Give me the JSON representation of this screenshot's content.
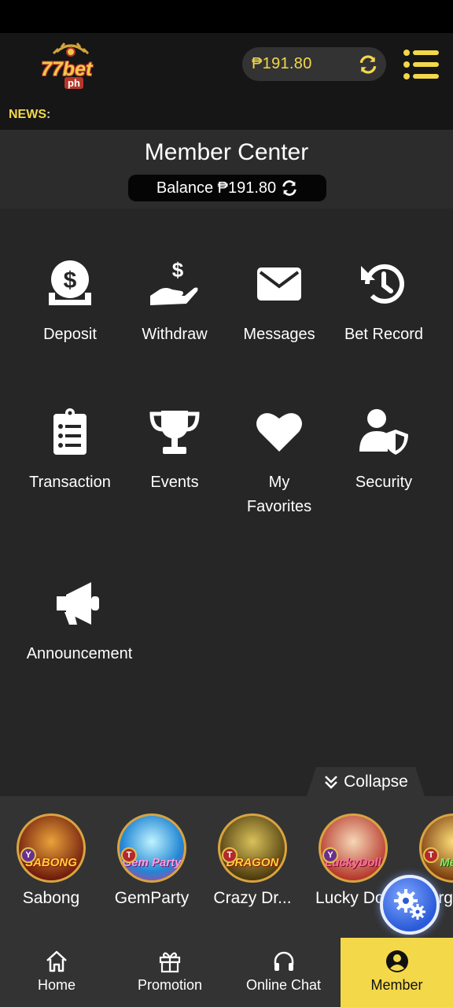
{
  "header": {
    "logo_text": "77bet",
    "logo_sub": "ph",
    "balance_amount": "₱191.80"
  },
  "news": {
    "label": "NEWS",
    "colon": ":"
  },
  "member_center": {
    "title": "Member Center",
    "balance_text": "Balance ₱191.80"
  },
  "menu": {
    "deposit": "Deposit",
    "withdraw": "Withdraw",
    "messages": "Messages",
    "bet_record": "Bet Record",
    "transaction": "Transaction",
    "events": "Events",
    "my_favorites_line1": "My",
    "my_favorites_line2": "Favorites",
    "security": "Security",
    "announcement": "Announcement"
  },
  "collapse": {
    "label": "Collapse"
  },
  "games": [
    {
      "name": "Sabong",
      "art": "SABONG",
      "badge": "Y"
    },
    {
      "name": "GemParty",
      "art": "Gem Party",
      "badge": "T"
    },
    {
      "name": "Crazy Dr...",
      "art": "DRAGON",
      "badge": "T"
    },
    {
      "name": "Lucky Do",
      "art": "LuckyDoll",
      "badge": "Y"
    },
    {
      "name": "rg",
      "art": "Me K",
      "badge": "T"
    }
  ],
  "tabbar": {
    "home": "Home",
    "promotion": "Promotion",
    "online_chat": "Online Chat",
    "member": "Member"
  },
  "colors": {
    "accent_yellow": "#f3d84a",
    "background": "#262626",
    "fab_blue": "#2a5bd8"
  },
  "icons": {
    "deposit": "money-bag-icon",
    "withdraw": "hand-dollar-icon",
    "messages": "envelope-icon",
    "bet_record": "history-icon",
    "transaction": "clipboard-list-icon",
    "events": "trophy-icon",
    "my_favorites": "heart-icon",
    "security": "user-shield-icon",
    "announcement": "megaphone-icon"
  }
}
